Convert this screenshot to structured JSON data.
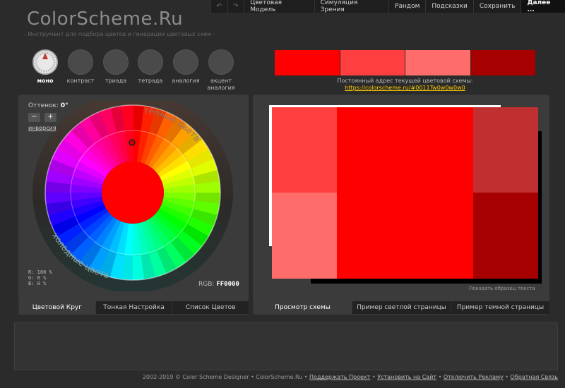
{
  "site": {
    "title": "ColorScheme.Ru",
    "tagline": "- Инструмент для подбора цветов и генерации цветовых схем -"
  },
  "topmenu": {
    "back_icon": "undo-icon",
    "forward_icon": "redo-icon",
    "items": [
      "Цветовая Модель",
      "Симуляция Зрения",
      "Рандом",
      "Подсказки",
      "Сохранить",
      "Далее ..."
    ]
  },
  "schemes": [
    {
      "label": "моно",
      "active": true
    },
    {
      "label": "контраст"
    },
    {
      "label": "триада"
    },
    {
      "label": "тетрада"
    },
    {
      "label": "аналогия"
    },
    {
      "label": "акцент\nаналогия"
    }
  ],
  "palette": {
    "colors": [
      "#FF0000",
      "#FF3F3F",
      "#FF6C6C",
      "#A70000"
    ],
    "label": "Постоянный адрес текущей цветовой схемы:",
    "link": "https://colorscheme.ru/#0011Tw0w0w0w0"
  },
  "wheel": {
    "hue_label": "Оттенок:",
    "hue_value": "0°",
    "minus": "−",
    "plus": "+",
    "inversion": "инверсия",
    "warm_label": "тёплые цвета",
    "cold_label": "холодные цвета",
    "selected_color": "#FF0000",
    "rgb": {
      "r": "R: 100 %",
      "g": "G:     0 %",
      "b": "B:     0 %"
    },
    "rgb_label": "RGB:",
    "rgb_hex": "FF0000"
  },
  "left_tabs": [
    "Цветовой Круг",
    "Тонкая Настройка",
    "Список Цветов"
  ],
  "preview": {
    "cells": [
      "#FF3F3F",
      "#FF0000",
      "#C03030",
      "#FF6C6C",
      "#A70000"
    ],
    "sample_text_link": "Показать образец текста"
  },
  "right_tabs": [
    "Просмотр схемы",
    "Пример светлой страницы",
    "Пример темной страницы"
  ],
  "footer": {
    "copyright": "2002-2019 © Color Scheme Designer • ColorScheme.Ru •",
    "links": [
      "Поддержать Проект",
      "Установить на Сайт",
      "Отключить Рекламу",
      "Обратная Связь"
    ]
  }
}
